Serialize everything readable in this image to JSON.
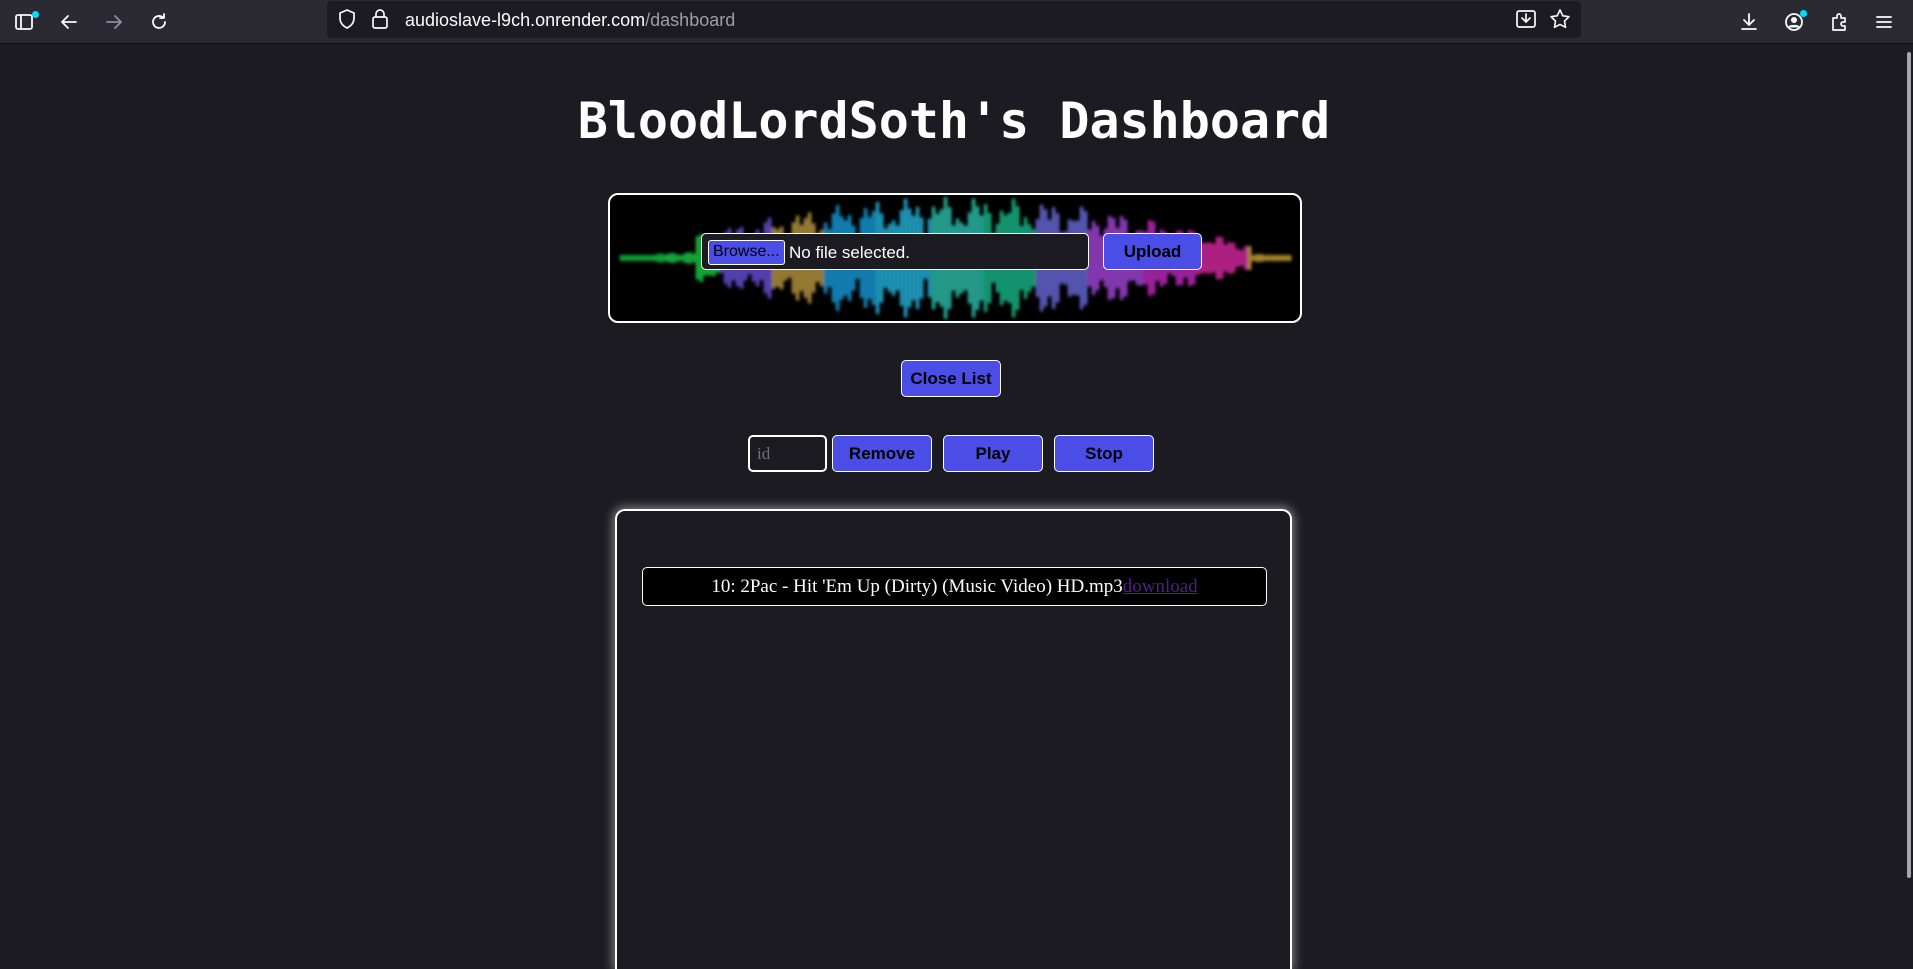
{
  "browser": {
    "url_host": "audioslave-l9ch.onrender.com",
    "url_path": "/dashboard",
    "accent_color": "#00ddff"
  },
  "page": {
    "title": "BloodLordSoth's Dashboard"
  },
  "upload": {
    "browse_label": "Browse...",
    "file_status": "No file selected.",
    "upload_label": "Upload"
  },
  "controls": {
    "close_list_label": "Close List",
    "id_placeholder": "id",
    "remove_label": "Remove",
    "play_label": "Play",
    "stop_label": "Stop"
  },
  "list": {
    "items": [
      {
        "text": "10: 2Pac - Hit 'Em Up (Dirty) (Music Video) HD.mp3",
        "link_label": "download"
      }
    ]
  },
  "theme": {
    "button_color": "#4b4ee6",
    "background": "#1c1b22",
    "visited_link_color": "#551a8b"
  }
}
